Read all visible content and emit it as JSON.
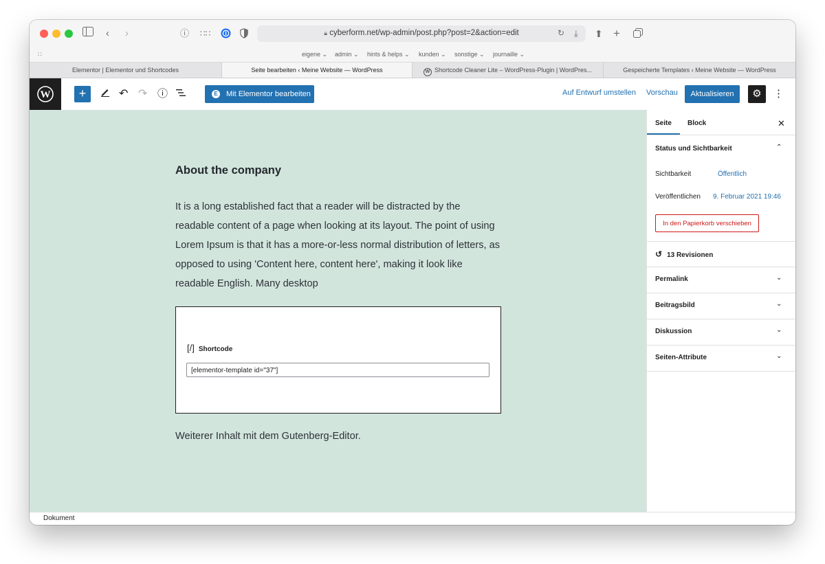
{
  "browser": {
    "url": "cyberform.net/wp-admin/post.php?post=2&action=edit",
    "bookmarks": [
      "eigene ⌄",
      "admin ⌄",
      "hints & helps ⌄",
      "kunden ⌄",
      "sonstige ⌄",
      "journaille ⌄"
    ],
    "tabs": [
      {
        "label": "Elementor | Elementor und Shortcodes",
        "active": false
      },
      {
        "label": "Seite bearbeiten ‹ Meine Website — WordPress",
        "active": true
      },
      {
        "label": "Shortcode Cleaner Lite – WordPress-Plugin | WordPres...",
        "active": false
      },
      {
        "label": "Gespeicherte Templates ‹ Meine Website — WordPress",
        "active": false
      }
    ]
  },
  "toolbar": {
    "elementor_label": "Mit Elementor bearbeiten",
    "draft_label": "Auf Entwurf umstellen",
    "preview_label": "Vorschau",
    "update_label": "Aktualisieren"
  },
  "content": {
    "heading": "About the company",
    "paragraph": "It is a long established fact that a reader will be distracted by the readable content of a page when looking at its layout. The point of using Lorem Ipsum is that it has a more-or-less normal distribution of letters, as opposed to using 'Content here, content here', making it look like readable English. Many desktop",
    "shortcode_title": "Shortcode",
    "shortcode_icon": "[/]",
    "shortcode_value": "[elementor-template id=\"37\"]",
    "after_text": "Weiterer Inhalt mit dem Gutenberg-Editor."
  },
  "sidebar": {
    "tab_page": "Seite",
    "tab_block": "Block",
    "status_title": "Status und Sichtbarkeit",
    "visibility_label": "Sichtbarkeit",
    "visibility_value": "Öffentlich",
    "publish_label": "Veröffentlichen",
    "publish_value": "9. Februar 2021 19:46",
    "trash_label": "In den Papierkorb verschieben",
    "revisions_label": "13 Revisionen",
    "panels": [
      "Permalink",
      "Beitragsbild",
      "Diskussion",
      "Seiten-Attribute"
    ]
  },
  "footer": {
    "label": "Dokument"
  },
  "colors": {
    "accent": "#2271b1",
    "canvas_bg": "#d2e5dd",
    "danger": "#cc1818"
  }
}
